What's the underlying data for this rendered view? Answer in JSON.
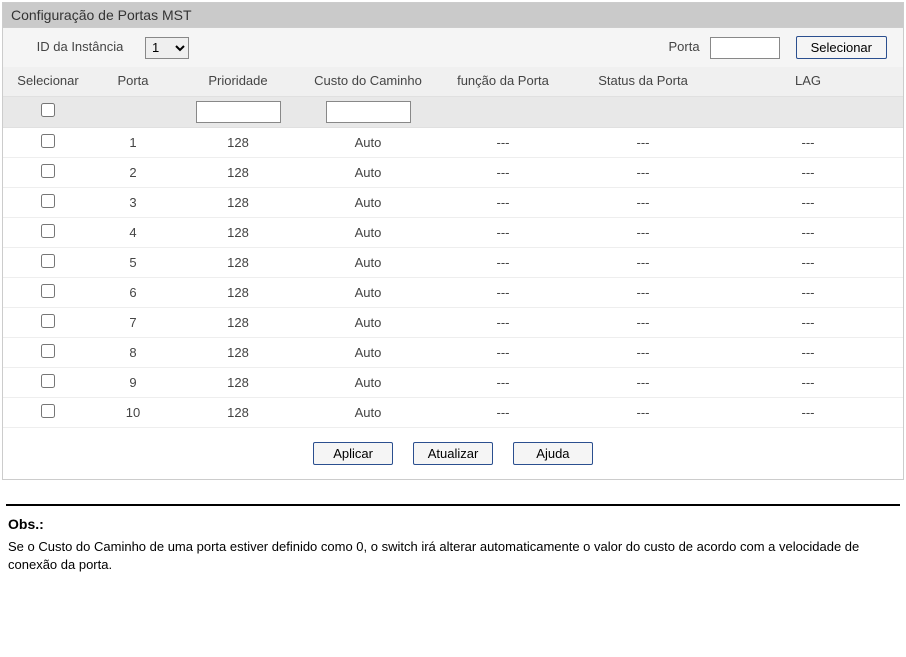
{
  "panel": {
    "title": "Configuração de Portas MST"
  },
  "config": {
    "instance_label": "ID da Instância",
    "instance_selected": "1",
    "instance_options": [
      "1"
    ],
    "porta_label": "Porta",
    "porta_value": "",
    "select_button": "Selecionar"
  },
  "table": {
    "headers": {
      "select": "Selecionar",
      "porta": "Porta",
      "prioridade": "Prioridade",
      "custo": "Custo do Caminho",
      "funcao": "função da Porta",
      "status": "Status da Porta",
      "lag": "LAG"
    },
    "filter": {
      "prioridade": "",
      "custo": ""
    },
    "rows": [
      {
        "porta": "1",
        "prioridade": "128",
        "custo": "Auto",
        "funcao": "---",
        "status": "---",
        "lag": "---"
      },
      {
        "porta": "2",
        "prioridade": "128",
        "custo": "Auto",
        "funcao": "---",
        "status": "---",
        "lag": "---"
      },
      {
        "porta": "3",
        "prioridade": "128",
        "custo": "Auto",
        "funcao": "---",
        "status": "---",
        "lag": "---"
      },
      {
        "porta": "4",
        "prioridade": "128",
        "custo": "Auto",
        "funcao": "---",
        "status": "---",
        "lag": "---"
      },
      {
        "porta": "5",
        "prioridade": "128",
        "custo": "Auto",
        "funcao": "---",
        "status": "---",
        "lag": "---"
      },
      {
        "porta": "6",
        "prioridade": "128",
        "custo": "Auto",
        "funcao": "---",
        "status": "---",
        "lag": "---"
      },
      {
        "porta": "7",
        "prioridade": "128",
        "custo": "Auto",
        "funcao": "---",
        "status": "---",
        "lag": "---"
      },
      {
        "porta": "8",
        "prioridade": "128",
        "custo": "Auto",
        "funcao": "---",
        "status": "---",
        "lag": "---"
      },
      {
        "porta": "9",
        "prioridade": "128",
        "custo": "Auto",
        "funcao": "---",
        "status": "---",
        "lag": "---"
      },
      {
        "porta": "10",
        "prioridade": "128",
        "custo": "Auto",
        "funcao": "---",
        "status": "---",
        "lag": "---"
      }
    ]
  },
  "buttons": {
    "apply": "Aplicar",
    "refresh": "Atualizar",
    "help": "Ajuda"
  },
  "note": {
    "title": "Obs.:",
    "text": "Se o Custo do Caminho de uma porta estiver definido como 0, o switch irá alterar automaticamente o valor do custo de acordo com a velocidade de conexão da porta."
  }
}
